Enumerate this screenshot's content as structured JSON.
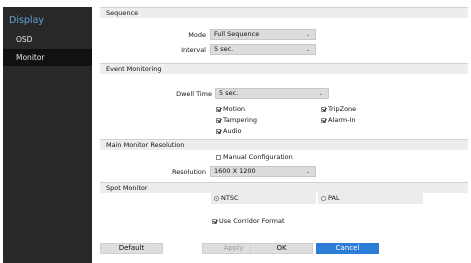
{
  "sidebar": {
    "title": "Display",
    "items": [
      {
        "label": "OSD"
      },
      {
        "label": "Monitor"
      }
    ]
  },
  "sequence": {
    "header": "Sequence",
    "mode_label": "Mode",
    "mode_value": "Full Sequence",
    "interval_label": "Interval",
    "interval_value": "5 sec."
  },
  "event_monitoring": {
    "header": "Event Monitoring",
    "dwell_label": "Dwell Time",
    "dwell_value": "5 sec.",
    "options": [
      {
        "label": "Motion",
        "checked": true
      },
      {
        "label": "TripZone",
        "checked": true
      },
      {
        "label": "Tampering",
        "checked": true
      },
      {
        "label": "Alarm-In",
        "checked": true
      },
      {
        "label": "Audio",
        "checked": true
      }
    ]
  },
  "main_monitor": {
    "header": "Main Monitor Resolution",
    "manual_label": "Manual Configuration",
    "manual_checked": false,
    "resolution_label": "Resolution",
    "resolution_value": "1600 X 1200"
  },
  "spot_monitor": {
    "header": "Spot Monitor",
    "ntsc_label": "NTSC",
    "pal_label": "PAL",
    "selected": "NTSC",
    "corridor_label": "Use Corridor Format",
    "corridor_checked": true
  },
  "buttons": {
    "default": "Default",
    "apply": "Apply",
    "ok": "OK",
    "cancel": "Cancel"
  },
  "colors": {
    "accent": "#2b7dd6",
    "sidebar_title": "#5ea3d8",
    "sidebar_bg": "#242424",
    "sidebar_selected": "#111111"
  }
}
